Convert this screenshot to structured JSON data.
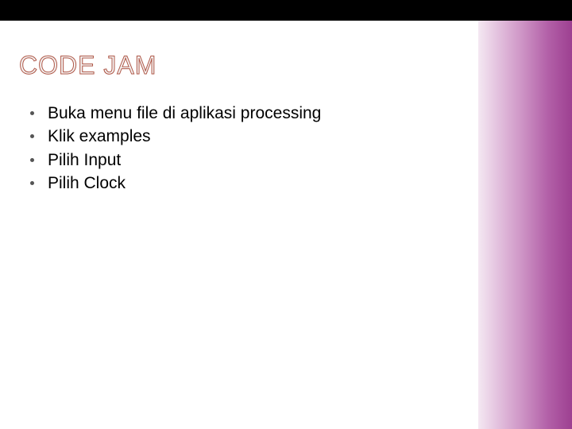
{
  "slide": {
    "title": "CODE JAM",
    "bullets": [
      "Buka menu file di aplikasi processing",
      "Klik examples",
      "Pilih Input",
      "Pilih Clock"
    ]
  }
}
